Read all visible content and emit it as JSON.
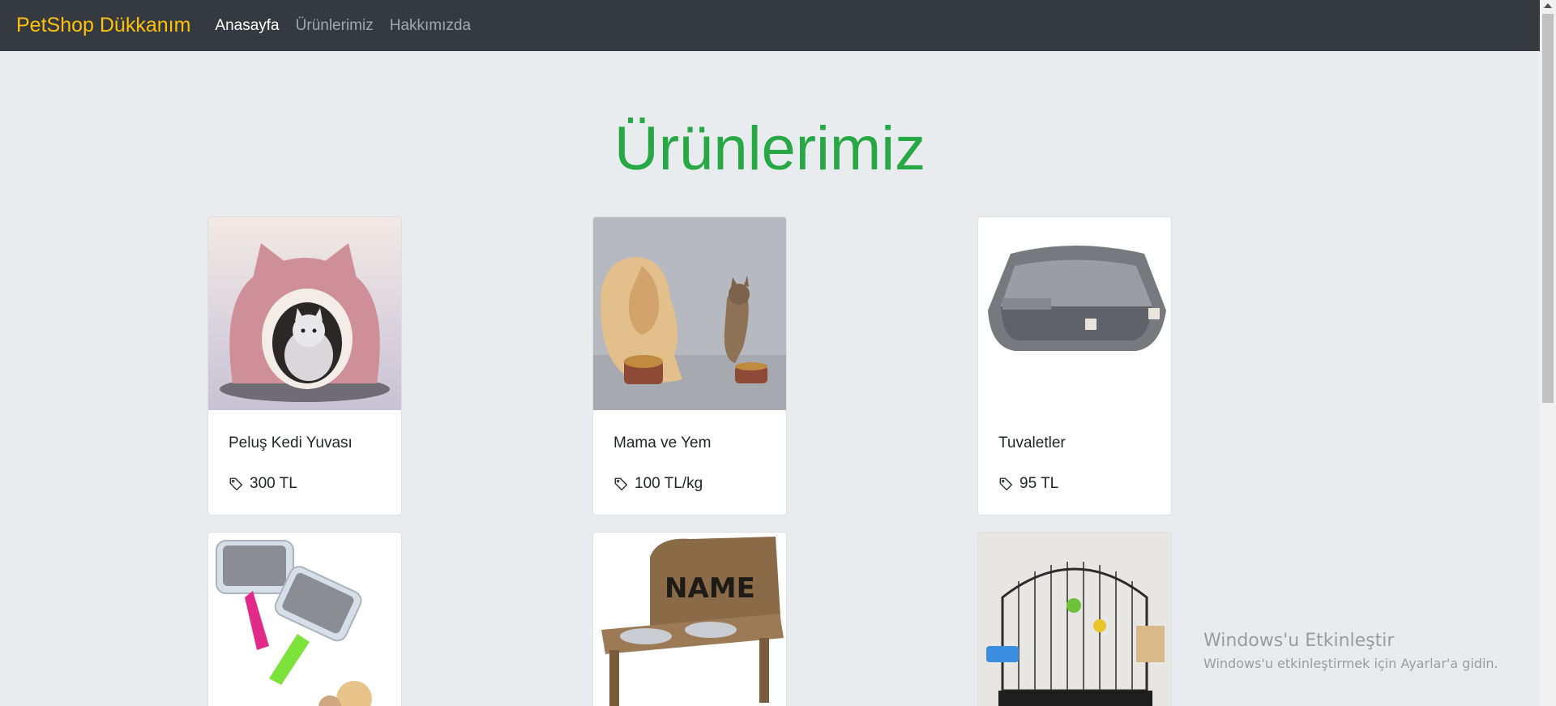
{
  "navbar": {
    "brand": "PetShop Dükkanım",
    "links": [
      {
        "label": "Anasayfa",
        "active": true
      },
      {
        "label": "Ürünlerimiz",
        "active": false
      },
      {
        "label": "Hakkımızda",
        "active": false
      }
    ]
  },
  "page_title": "Ürünlerimiz",
  "products": [
    {
      "title": "Peluş Kedi Yuvası",
      "price": "300 TL",
      "image": "pink-cat-bed-image"
    },
    {
      "title": "Mama ve Yem",
      "price": "100 TL/kg",
      "image": "dog-and-cat-eating-image"
    },
    {
      "title": "Tuvaletler",
      "price": "95 TL",
      "image": "grey-litter-box-image"
    },
    {
      "title": "",
      "price": "",
      "image": "pet-grooming-brushes-image"
    },
    {
      "title": "",
      "price": "",
      "image": "wooden-pet-bowl-stand-image"
    },
    {
      "title": "",
      "price": "",
      "image": "bird-cage-image"
    }
  ],
  "bowl_stand_text": "NAME",
  "watermark": {
    "line1": "Windows'u Etkinleştir",
    "line2": "Windows'u etkinleştirmek için Ayarlar'a gidin."
  },
  "colors": {
    "navbar_bg": "#343a40",
    "brand": "#ffc107",
    "title": "#28a745",
    "page_bg": "#e9ecef"
  }
}
